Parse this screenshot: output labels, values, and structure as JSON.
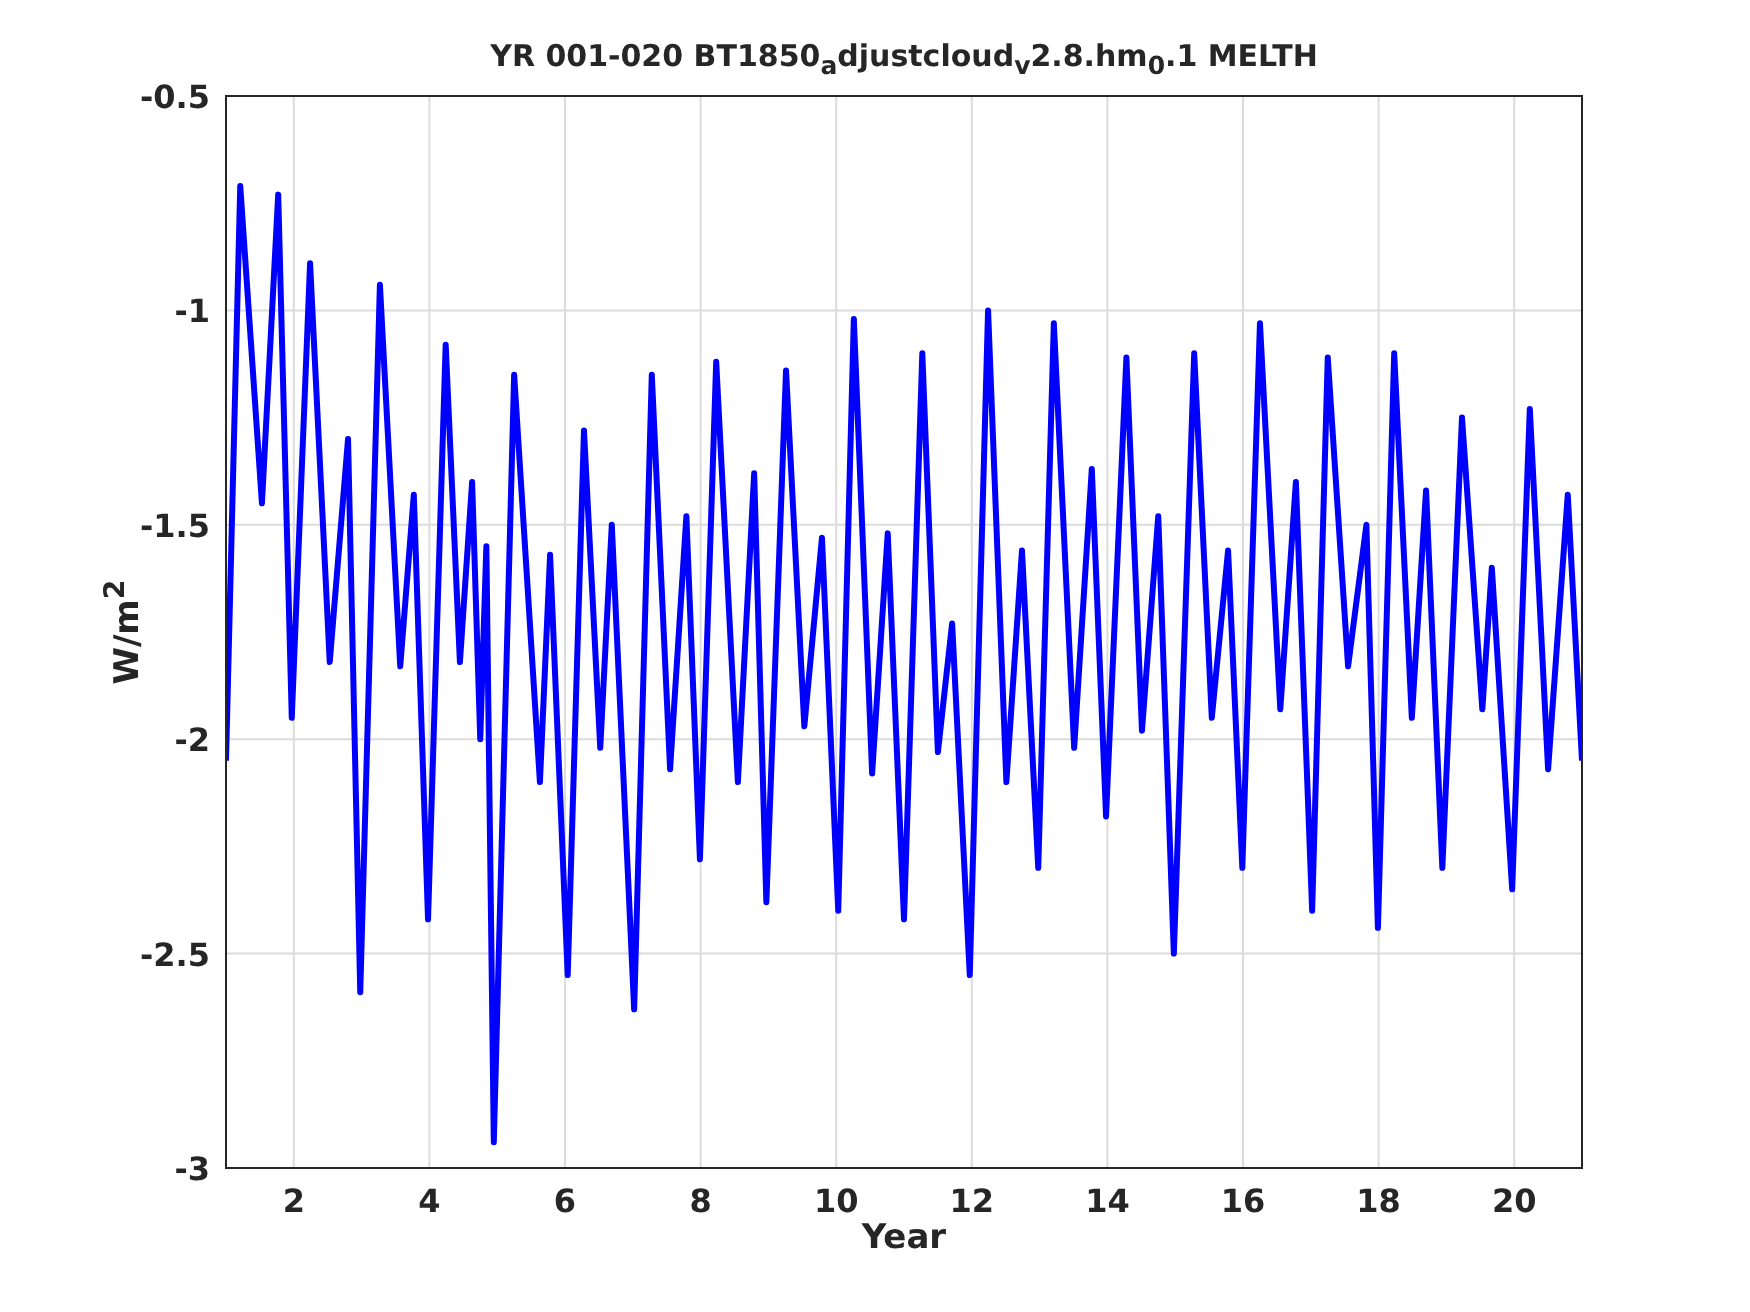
{
  "chart_data": {
    "type": "line",
    "title": "YR 001-020 BT1850$_{a}$djustcloud$_{v}$2.8.hm$_{0}$.1 MELTH",
    "xlabel": "Year",
    "ylabel": "W/m$^{2}$",
    "x": [
      1.0,
      1.21,
      1.53,
      1.77,
      1.97,
      2.24,
      2.53,
      2.8,
      2.98,
      3.27,
      3.57,
      3.77,
      3.98,
      4.24,
      4.45,
      4.63,
      4.75,
      4.84,
      4.95,
      5.25,
      5.63,
      5.78,
      6.04,
      6.28,
      6.52,
      6.69,
      7.02,
      7.28,
      7.55,
      7.79,
      7.99,
      8.23,
      8.55,
      8.79,
      8.97,
      9.26,
      9.53,
      9.79,
      10.03,
      10.26,
      10.53,
      10.76,
      11.0,
      11.27,
      11.5,
      11.71,
      11.97,
      12.24,
      12.51,
      12.74,
      12.98,
      13.21,
      13.51,
      13.77,
      13.98,
      14.28,
      14.51,
      14.75,
      14.98,
      15.28,
      15.54,
      15.78,
      15.99,
      16.25,
      16.55,
      16.78,
      17.02,
      17.25,
      17.55,
      17.82,
      17.99,
      18.23,
      18.49,
      18.7,
      18.94,
      19.23,
      19.53,
      19.67,
      19.97,
      20.23,
      20.5,
      20.79,
      21.0
    ],
    "grid": true,
    "series": [
      {
        "color": "#0000ff",
        "values": [
          -2.05,
          -0.71,
          -1.45,
          -0.73,
          -1.95,
          -0.89,
          -1.82,
          -1.3,
          -2.59,
          -0.94,
          -1.83,
          -1.43,
          -2.42,
          -1.08,
          -1.82,
          -1.4,
          -2.0,
          -1.55,
          -2.94,
          -1.15,
          -2.1,
          -1.57,
          -2.55,
          -1.28,
          -2.02,
          -1.5,
          -2.63,
          -1.15,
          -2.07,
          -1.48,
          -2.28,
          -1.12,
          -2.1,
          -1.38,
          -2.38,
          -1.14,
          -1.97,
          -1.53,
          -2.4,
          -1.02,
          -2.08,
          -1.52,
          -2.42,
          -1.1,
          -2.03,
          -1.73,
          -2.55,
          -1.0,
          -2.1,
          -1.56,
          -2.3,
          -1.03,
          -2.02,
          -1.37,
          -2.18,
          -1.11,
          -1.98,
          -1.48,
          -2.5,
          -1.1,
          -1.95,
          -1.56,
          -2.3,
          -1.03,
          -1.93,
          -1.4,
          -2.4,
          -1.11,
          -1.83,
          -1.5,
          -2.44,
          -1.1,
          -1.95,
          -1.42,
          -2.3,
          -1.25,
          -1.93,
          -1.6,
          -2.35,
          -1.23,
          -2.07,
          -1.43,
          -2.05
        ]
      }
    ],
    "xlim": [
      1,
      21
    ],
    "ylim": [
      -3,
      -0.5
    ],
    "xticks": [
      2,
      4,
      6,
      8,
      10,
      12,
      14,
      16,
      18,
      20
    ],
    "yticks": [
      -3,
      -2.5,
      -2,
      -1.5,
      -1,
      -0.5
    ]
  }
}
